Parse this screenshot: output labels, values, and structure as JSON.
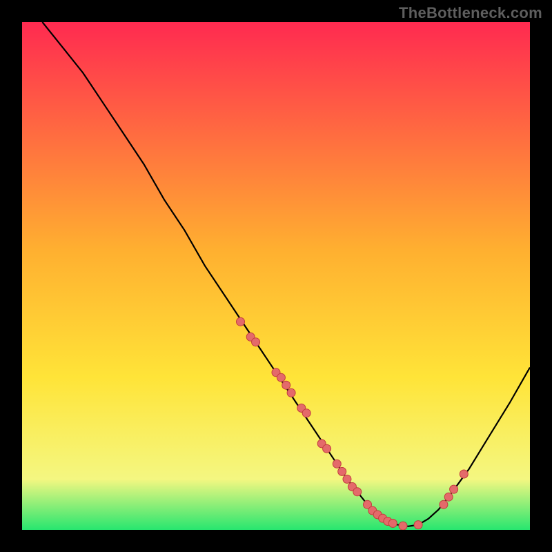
{
  "watermark": "TheBottleneck.com",
  "colors": {
    "background": "#000000",
    "grad_top": "#ff2a50",
    "grad_mid": "#ffd028",
    "grad_low": "#f7f27a",
    "grad_bottom": "#27e66f",
    "curve": "#000000",
    "dot_fill": "#e46a6a",
    "dot_stroke": "#c23d3d"
  },
  "chart_data": {
    "type": "line",
    "title": "",
    "xlabel": "",
    "ylabel": "",
    "xlim": [
      0,
      100
    ],
    "ylim": [
      0,
      100
    ],
    "series": [
      {
        "name": "bottleneck-curve",
        "x": [
          4,
          8,
          12,
          16,
          20,
          24,
          28,
          32,
          36,
          40,
          44,
          48,
          52,
          56,
          60,
          62,
          64,
          66,
          68,
          70,
          72,
          74,
          76,
          78,
          80,
          82,
          84,
          88,
          92,
          96,
          100
        ],
        "y": [
          100,
          95,
          90,
          84,
          78,
          72,
          65,
          59,
          52,
          46,
          40,
          34,
          28,
          22,
          16,
          13,
          10,
          7.5,
          5,
          3,
          1.7,
          1,
          0.7,
          1,
          2.2,
          4,
          6.5,
          12,
          18.5,
          25,
          32
        ]
      }
    ],
    "dots": {
      "name": "sample-points",
      "x": [
        43,
        45,
        46,
        50,
        51,
        52,
        53,
        55,
        56,
        59,
        60,
        62,
        63,
        64,
        65,
        66,
        68,
        69,
        70,
        71,
        72,
        73,
        75,
        78,
        83,
        84,
        85,
        87
      ],
      "y": [
        41,
        38,
        37,
        31,
        30,
        28.5,
        27,
        24,
        23,
        17,
        16,
        13,
        11.5,
        10,
        8.5,
        7.5,
        5,
        3.8,
        3,
        2.3,
        1.7,
        1.3,
        0.8,
        1,
        5,
        6.5,
        8,
        11
      ]
    }
  }
}
